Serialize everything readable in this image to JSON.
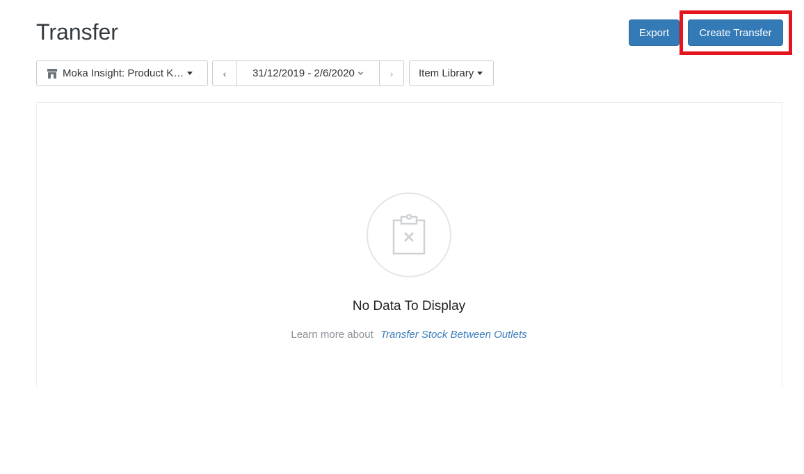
{
  "header": {
    "title": "Transfer",
    "export_label": "Export",
    "create_label": "Create Transfer"
  },
  "filters": {
    "outlet_label": "Moka Insight: Product K…",
    "date_range": "31/12/2019 - 2/6/2020",
    "prev_label": "‹",
    "next_label": "›",
    "library_label": "Item Library"
  },
  "empty_state": {
    "title": "No Data To Display",
    "learn_prefix": "Learn more about",
    "learn_link": "Transfer Stock Between Outlets"
  },
  "colors": {
    "primary": "#337ab7",
    "highlight": "#e3141d",
    "link": "#3b7dbb"
  }
}
